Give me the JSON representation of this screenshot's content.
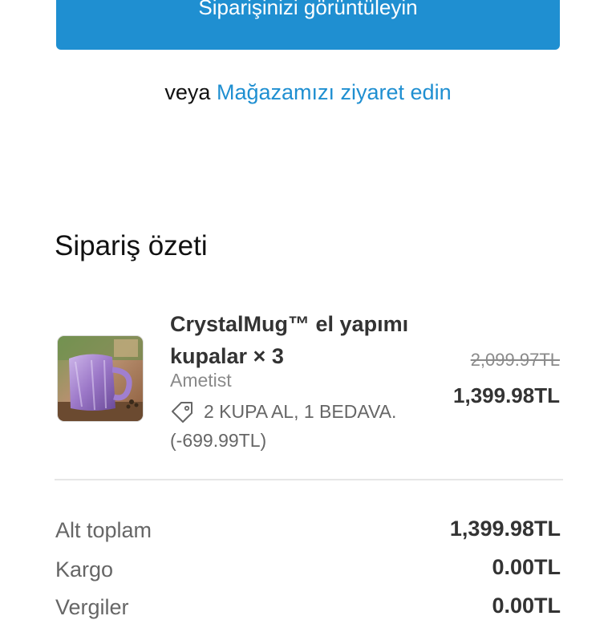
{
  "actions": {
    "view_order_label": "Siparişinizi görüntüleyin",
    "or_text": "veya",
    "visit_store_label": "Mağazamızı ziyaret edin"
  },
  "summary": {
    "title": "Sipariş özeti",
    "item": {
      "name": "CrystalMug™ el yapımı kupalar × 3",
      "variant": "Ametist",
      "discount_code": "2 KUPA AL, 1 BEDAVA.",
      "discount_amount": "(-699.99TL)",
      "original_price": "2,099.97TL",
      "final_price": "1,399.98TL",
      "icon": "tag-icon"
    },
    "rows": [
      {
        "label": "Alt toplam",
        "value": "1,399.98TL"
      },
      {
        "label": "Kargo",
        "value": "0.00TL"
      },
      {
        "label": "Vergiler",
        "value": "0.00TL"
      }
    ]
  },
  "colors": {
    "accent": "#1f8fd1",
    "text_primary": "#333333",
    "text_muted": "#8a8a8a",
    "divider": "#e6e6e6"
  }
}
